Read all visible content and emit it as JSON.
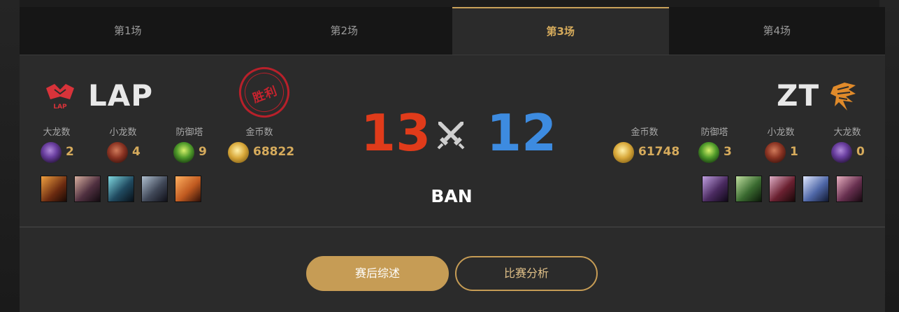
{
  "tabs": [
    {
      "label": "第1场",
      "active": false
    },
    {
      "label": "第2场",
      "active": false
    },
    {
      "label": "第3场",
      "active": true
    },
    {
      "label": "第4场",
      "active": false
    }
  ],
  "team_left": {
    "name": "LAP",
    "logo_icon": "lap-logo-icon",
    "logo_text": "LAP",
    "result_stamp": "胜利",
    "stats": [
      {
        "label": "大龙数",
        "value": "2",
        "icon": "baron-icon"
      },
      {
        "label": "小龙数",
        "value": "4",
        "icon": "dragon-icon"
      },
      {
        "label": "防御塔",
        "value": "9",
        "icon": "tower-icon"
      },
      {
        "label": "金币数",
        "value": "68822",
        "icon": "gold-icon"
      }
    ]
  },
  "team_right": {
    "name": "ZT",
    "logo_icon": "zt-logo-icon",
    "stats": [
      {
        "label": "金币数",
        "value": "61748",
        "icon": "gold-icon"
      },
      {
        "label": "防御塔",
        "value": "3",
        "icon": "tower-icon"
      },
      {
        "label": "小龙数",
        "value": "1",
        "icon": "dragon-icon"
      },
      {
        "label": "大龙数",
        "value": "0",
        "icon": "baron-icon"
      }
    ]
  },
  "score": {
    "left": "13",
    "right": "12",
    "left_color": "#e03b1a",
    "right_color": "#3d8be0"
  },
  "ban_label": "BAN",
  "buttons": {
    "summary": "赛后综述",
    "analysis": "比赛分析"
  },
  "colors": {
    "accent": "#c69c55",
    "stamp": "#b8202a"
  }
}
